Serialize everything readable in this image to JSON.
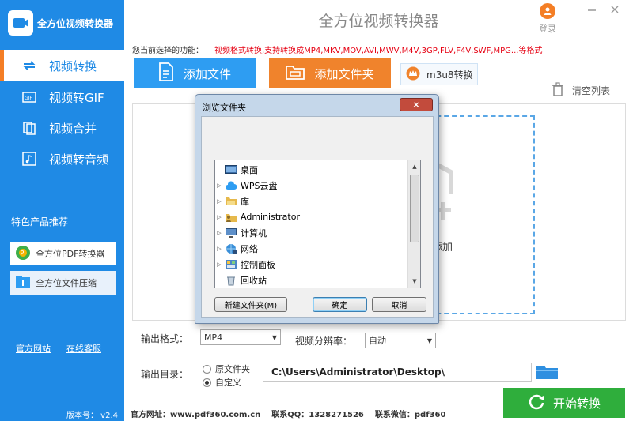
{
  "app": {
    "title": "全方位视频转换器",
    "logo_text": "全方位视频转换器",
    "login": "登录"
  },
  "sidebar": {
    "items": [
      {
        "label": "视频转换",
        "icon": "convert-icon",
        "active": true
      },
      {
        "label": "视频转GIF",
        "icon": "gif-icon",
        "active": false
      },
      {
        "label": "视频合并",
        "icon": "merge-icon",
        "active": false
      },
      {
        "label": "视频转音频",
        "icon": "music-icon",
        "active": false
      }
    ],
    "featured_title": "特色产品推荐",
    "products": [
      {
        "label": "全方位PDF转换器",
        "icon": "pdf-app-icon"
      },
      {
        "label": "全方位文件压缩",
        "icon": "zip-app-icon"
      }
    ],
    "links": {
      "website": "官方网站",
      "support": "在线客服"
    },
    "version": "版本号： v2.4"
  },
  "toolbar": {
    "func_label": "您当前选择的功能：",
    "func_value": "视频格式转换,支持转换成MP4,MKV,MOV,AVI,MWV,M4V,3GP,FLV,F4V,SWF,MPG...等格式",
    "add_file": "添加文件",
    "add_folder": "添加文件夹",
    "m3u8": "m3u8转换",
    "clear_list": "清空列表"
  },
  "drop_area": {
    "hint": "添加"
  },
  "settings": {
    "format_label": "输出格式：",
    "format_value": "MP4",
    "resolution_label": "视频分辨率：",
    "resolution_value": "自动",
    "dir_label": "输出目录：",
    "radio_original": "原文件夹",
    "radio_custom": "自定义",
    "path": "C:\\Users\\Administrator\\Desktop\\",
    "start": "开始转换"
  },
  "footer": {
    "website": "官方网址：www.pdf360.com.cn",
    "qq": "联系QQ：1328271526",
    "wechat": "联系微信：pdf360"
  },
  "dialog": {
    "title": "浏览文件夹",
    "tree": [
      {
        "label": "桌面",
        "icon": "desktop-icon",
        "expandable": false
      },
      {
        "label": "WPS云盘",
        "icon": "cloud-icon",
        "expandable": true
      },
      {
        "label": "库",
        "icon": "library-icon",
        "expandable": true
      },
      {
        "label": "Administrator",
        "icon": "user-folder-icon",
        "expandable": true
      },
      {
        "label": "计算机",
        "icon": "computer-icon",
        "expandable": true
      },
      {
        "label": "网络",
        "icon": "network-icon",
        "expandable": true
      },
      {
        "label": "控制面板",
        "icon": "control-panel-icon",
        "expandable": true
      },
      {
        "label": "回收站",
        "icon": "recycle-bin-icon",
        "expandable": false
      }
    ],
    "new_folder": "新建文件夹(M)",
    "ok": "确定",
    "cancel": "取消"
  },
  "colors": {
    "primary": "#1f8ae5",
    "orange": "#f0832c",
    "green": "#2fae3c",
    "red": "#e60012"
  }
}
